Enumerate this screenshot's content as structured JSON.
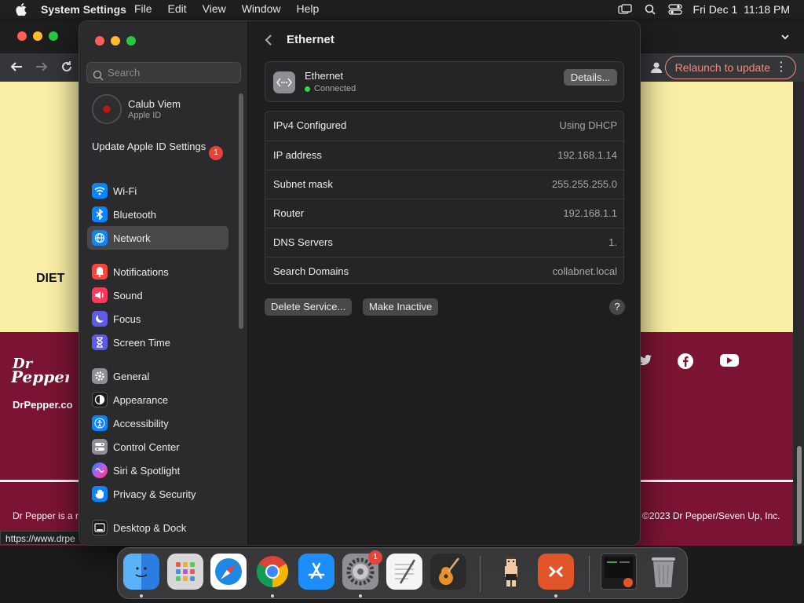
{
  "menubar": {
    "apple_icon": "apple-icon",
    "app_name": "System Settings",
    "menus": [
      "File",
      "Edit",
      "View",
      "Window",
      "Help"
    ],
    "status_icons": [
      "screen-mirroring-icon",
      "search-icon",
      "control-center-icon"
    ],
    "clock": "Fri Dec 1  11:18 PM"
  },
  "chrome": {
    "relaunch_label": "Relaunch to update",
    "relaunch_color": "#f28b82",
    "page": {
      "diet_text": "DIET",
      "site_url": "DrPepper.co",
      "left_footer": "Dr Pepper is a r",
      "copyright": "©2023 Dr Pepper/Seven Up, Inc.",
      "status_url": "https://www.drpe",
      "footer_color": "#7a1432",
      "banner_color": "#fbefa7"
    }
  },
  "settings": {
    "search_placeholder": "Search",
    "account": {
      "name": "Calub Viem",
      "subtitle": "Apple ID"
    },
    "update": {
      "label": "Update Apple ID Settings",
      "badge": "1"
    },
    "sidebar": [
      {
        "label": "Wi-Fi",
        "icon": "wifi-icon",
        "color": "#0a84ff"
      },
      {
        "label": "Bluetooth",
        "icon": "bluetooth-icon",
        "color": "#0a84ff"
      },
      {
        "label": "Network",
        "icon": "globe-icon",
        "color": "#0a84ff",
        "selected": true
      },
      {
        "label": "Notifications",
        "icon": "bell-icon",
        "color": "#ff453a"
      },
      {
        "label": "Sound",
        "icon": "speaker-icon",
        "color": "#ff375f"
      },
      {
        "label": "Focus",
        "icon": "moon-icon",
        "color": "#5e5ce6"
      },
      {
        "label": "Screen Time",
        "icon": "hourglass-icon",
        "color": "#5e5ce6"
      },
      {
        "label": "General",
        "icon": "gear-icon",
        "color": "#8e8e93"
      },
      {
        "label": "Appearance",
        "icon": "appearance-icon",
        "color": "#1c1c1e"
      },
      {
        "label": "Accessibility",
        "icon": "accessibility-icon",
        "color": "#0a84ff"
      },
      {
        "label": "Control Center",
        "icon": "control-center-icon",
        "color": "#8e8e93"
      },
      {
        "label": "Siri & Spotlight",
        "icon": "siri-icon",
        "color": "#bf5af2"
      },
      {
        "label": "Privacy & Security",
        "icon": "hand-icon",
        "color": "#0a84ff"
      },
      {
        "label": "Desktop & Dock",
        "icon": "dock-icon",
        "color": "#1c1c1e"
      }
    ],
    "content": {
      "title": "Ethernet",
      "service": {
        "name": "Ethernet",
        "status": "Connected",
        "status_color": "#32d74b",
        "details_label": "Details..."
      },
      "rows": [
        {
          "key": "IPv4 Configured",
          "value": "Using DHCP"
        },
        {
          "key": "IP address",
          "value": "192.168.1.14"
        },
        {
          "key": "Subnet mask",
          "value": "255.255.255.0"
        },
        {
          "key": "Router",
          "value": "192.168.1.1"
        },
        {
          "key": "DNS Servers",
          "value": "1."
        },
        {
          "key": "Search Domains",
          "value": "collabnet.local"
        }
      ],
      "delete_label": "Delete Service...",
      "inactive_label": "Make Inactive",
      "help_label": "?"
    }
  },
  "dock": {
    "apps": [
      {
        "name": "finder-icon",
        "running": true
      },
      {
        "name": "launchpad-icon",
        "running": false
      },
      {
        "name": "safari-icon",
        "running": false
      },
      {
        "name": "chrome-icon",
        "running": true
      },
      {
        "name": "app-store-icon",
        "running": false
      },
      {
        "name": "system-settings-icon",
        "running": true,
        "badge": "1"
      },
      {
        "name": "textedit-icon",
        "running": false
      },
      {
        "name": "garageband-icon",
        "running": false
      },
      {
        "name": "character-app-icon",
        "running": false
      },
      {
        "name": "remote-desktop-icon",
        "running": true
      },
      {
        "name": "terminal-window-icon",
        "running": false
      },
      {
        "name": "trash-icon",
        "running": false
      }
    ]
  }
}
